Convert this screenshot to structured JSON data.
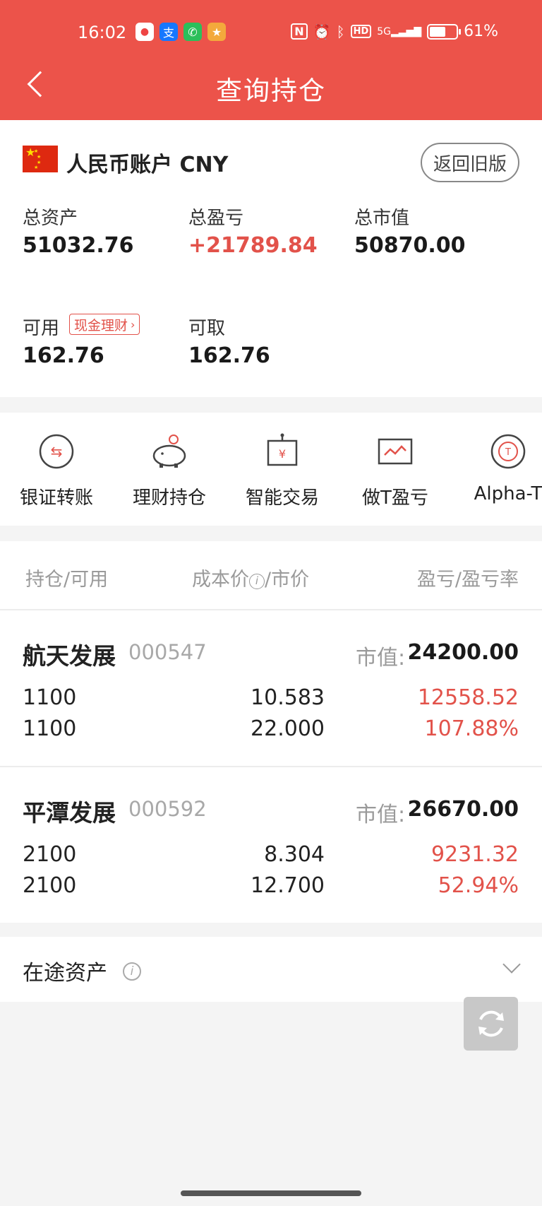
{
  "status_bar": {
    "time": "16:02",
    "battery_percent": "61%",
    "battery_level": 0.61,
    "network": "5G",
    "hd_label": "HD",
    "nfc_label": "N"
  },
  "header": {
    "title": "查询持仓"
  },
  "account": {
    "name": "人民币账户 CNY",
    "old_version_label": "返回旧版",
    "total_assets_label": "总资产",
    "total_assets_value": "51032.76",
    "total_pl_label": "总盈亏",
    "total_pl_value": "+21789.84",
    "total_mv_label": "总市值",
    "total_mv_value": "50870.00",
    "available_label": "可用",
    "cash_tag_label": "现金理财",
    "available_value": "162.76",
    "withdrawable_label": "可取",
    "withdrawable_value": "162.76"
  },
  "tools": [
    {
      "label": "银证转账",
      "icon": "bank-transfer-icon"
    },
    {
      "label": "理财持仓",
      "icon": "piggy-bank-icon"
    },
    {
      "label": "智能交易",
      "icon": "smart-trade-robot-icon"
    },
    {
      "label": "做T盈亏",
      "icon": "t-trade-chart-icon"
    },
    {
      "label": "Alpha-T",
      "icon": "alpha-t-icon"
    }
  ],
  "holdings": {
    "col_position": "持仓/可用",
    "col_cost": "成本价",
    "col_cost_info": "i",
    "col_price": "/市价",
    "col_pl": "盈亏/盈亏率",
    "market_value_label": "市值:",
    "rows": [
      {
        "name": "航天发展",
        "code": "000547",
        "market_value": "24200.00",
        "position": "1100",
        "available": "1100",
        "cost_price": "10.583",
        "market_price": "22.000",
        "pl": "12558.52",
        "pl_rate": "107.88%"
      },
      {
        "name": "平潭发展",
        "code": "000592",
        "market_value": "26670.00",
        "position": "2100",
        "available": "2100",
        "cost_price": "8.304",
        "market_price": "12.700",
        "pl": "9231.32",
        "pl_rate": "52.94%"
      }
    ]
  },
  "transit": {
    "label": "在途资产",
    "info": "i"
  },
  "colors": {
    "brand_red": "#ec534a",
    "profit_red": "#e2524a",
    "background": "#f4f4f4"
  }
}
